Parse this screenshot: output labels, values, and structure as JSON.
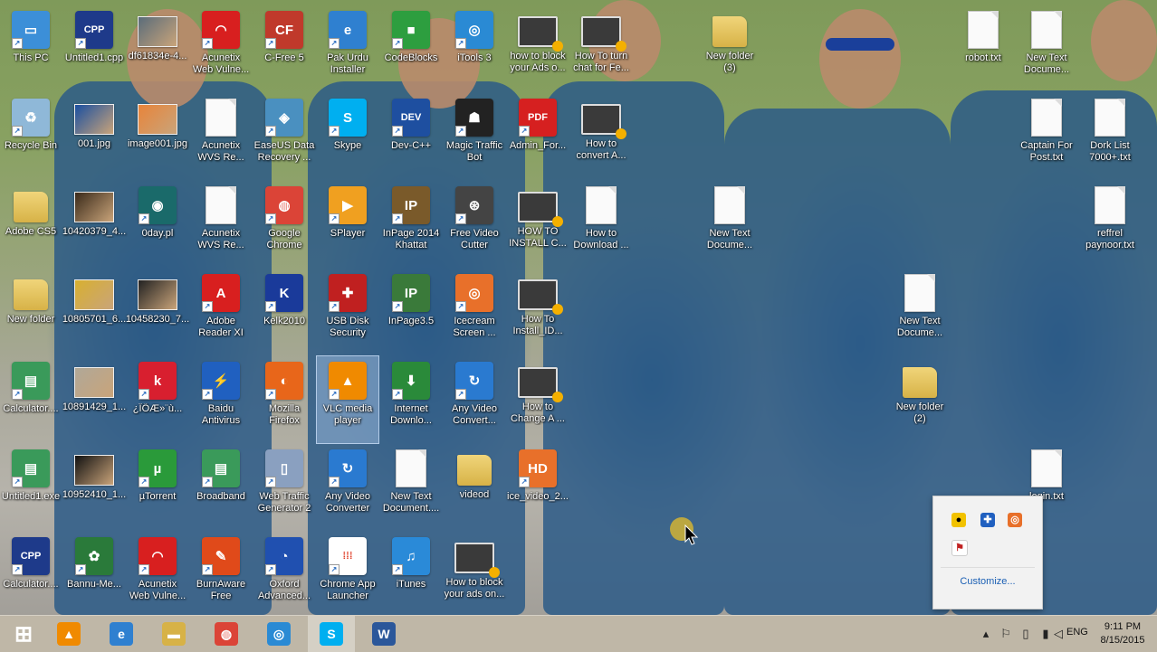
{
  "desktop": {
    "icons": [
      {
        "label": "This PC",
        "icon": "monitor-icon",
        "kind": "app",
        "color": "#3c8fd8",
        "glyph": "▭"
      },
      {
        "label": "Untitled1.cpp",
        "icon": "cpp-file-icon",
        "kind": "app",
        "color": "#1e3a8a",
        "glyph": "CPP"
      },
      {
        "label": "df61834e-4...",
        "icon": "image-file-icon",
        "kind": "photo",
        "color": "#5a6c7a",
        "glyph": ""
      },
      {
        "label": "Acunetix\nWeb Vulne...",
        "icon": "acunetix-icon",
        "kind": "app",
        "color": "#d81f1f",
        "glyph": "◠"
      },
      {
        "label": "C-Free 5",
        "icon": "cfree-icon",
        "kind": "app",
        "color": "#c0392b",
        "glyph": "CF"
      },
      {
        "label": "Pak Urdu\nInstaller",
        "icon": "internet-explorer-icon",
        "kind": "app",
        "color": "#2f80d0",
        "glyph": "e"
      },
      {
        "label": "CodeBlocks",
        "icon": "codeblocks-icon",
        "kind": "app",
        "color": "#2d9e3f",
        "glyph": "■"
      },
      {
        "label": "iTools 3",
        "icon": "itools-icon",
        "kind": "app",
        "color": "#2a8ad4",
        "glyph": "◎"
      },
      {
        "label": "how to block\nyour Ads o...",
        "icon": "video-file-icon",
        "kind": "video",
        "color": "#333333",
        "glyph": ""
      },
      {
        "label": "How To turn\nchat for Fe...",
        "icon": "video-file-icon",
        "kind": "video",
        "color": "#333333",
        "glyph": ""
      },
      {
        "label": "New folder\n(3)",
        "icon": "folder-icon",
        "kind": "folder",
        "color": "#e0c060",
        "glyph": ""
      },
      {
        "label": "robot.txt",
        "icon": "text-file-icon",
        "kind": "txt",
        "color": "#fafafa",
        "glyph": ""
      },
      {
        "label": "New Text\nDocume...",
        "icon": "text-file-icon",
        "kind": "txt",
        "color": "#fafafa",
        "glyph": ""
      },
      {
        "label": "Recycle Bin",
        "icon": "recycle-bin-icon",
        "kind": "app",
        "color": "#8fb8d8",
        "glyph": "♻"
      },
      {
        "label": "001.jpg",
        "icon": "image-file-icon",
        "kind": "photo",
        "color": "#1a4fa0",
        "glyph": ""
      },
      {
        "label": "image001.jpg",
        "icon": "image-file-icon",
        "kind": "photo",
        "color": "#e8843a",
        "glyph": ""
      },
      {
        "label": "Acunetix\nWVS Re...",
        "icon": "document-icon",
        "kind": "txt",
        "color": "#fafafa",
        "glyph": ""
      },
      {
        "label": "EaseUS Data\nRecovery ...",
        "icon": "easeus-icon",
        "kind": "app",
        "color": "#4a90c0",
        "glyph": "◈"
      },
      {
        "label": "Skype",
        "icon": "skype-icon",
        "kind": "app",
        "color": "#00aff0",
        "glyph": "S"
      },
      {
        "label": "Dev-C++",
        "icon": "devcpp-icon",
        "kind": "app",
        "color": "#1e4fa0",
        "glyph": "DEV"
      },
      {
        "label": "Magic Traffic\nBot",
        "icon": "magic-traffic-bot-icon",
        "kind": "app",
        "color": "#222222",
        "glyph": "☗"
      },
      {
        "label": "Admin_For...",
        "icon": "pdf-file-icon",
        "kind": "app",
        "color": "#d62020",
        "glyph": "PDF"
      },
      {
        "label": "How to\nconvert A...",
        "icon": "video-file-icon",
        "kind": "video",
        "color": "#333333",
        "glyph": ""
      },
      {
        "label": "Captain For\nPost.txt",
        "icon": "text-file-icon",
        "kind": "txt",
        "color": "#fafafa",
        "glyph": ""
      },
      {
        "label": "Dork List\n7000+.txt",
        "icon": "text-file-icon",
        "kind": "txt",
        "color": "#fafafa",
        "glyph": ""
      },
      {
        "label": "Adobe CS5",
        "icon": "folder-icon",
        "kind": "folder",
        "color": "#e0c060",
        "glyph": ""
      },
      {
        "label": "10420379_4...",
        "icon": "image-file-icon",
        "kind": "photo",
        "color": "#3a2a1a",
        "glyph": ""
      },
      {
        "label": "0day.pl",
        "icon": "0day-icon",
        "kind": "app",
        "color": "#1a6a6a",
        "glyph": "◉"
      },
      {
        "label": "Acunetix\nWVS Re...",
        "icon": "document-icon",
        "kind": "txt",
        "color": "#fafafa",
        "glyph": ""
      },
      {
        "label": "Google\nChrome",
        "icon": "chrome-icon",
        "kind": "app",
        "color": "#db4437",
        "glyph": "◍"
      },
      {
        "label": "SPlayer",
        "icon": "splayer-icon",
        "kind": "app",
        "color": "#f0a020",
        "glyph": "▶"
      },
      {
        "label": "InPage 2014\nKhattat",
        "icon": "inpage-icon",
        "kind": "app",
        "color": "#7a5a2a",
        "glyph": "IP"
      },
      {
        "label": "Free Video\nCutter",
        "icon": "film-reel-icon",
        "kind": "app",
        "color": "#444444",
        "glyph": "⊛"
      },
      {
        "label": "HOW TO\nINSTALL C...",
        "icon": "video-file-icon",
        "kind": "video",
        "color": "#333333",
        "glyph": ""
      },
      {
        "label": "How to\nDownload ...",
        "icon": "word-document-icon",
        "kind": "txt",
        "color": "#fafafa",
        "glyph": ""
      },
      {
        "label": "New Text\nDocume...",
        "icon": "text-file-icon",
        "kind": "txt",
        "color": "#fafafa",
        "glyph": ""
      },
      {
        "label": "reffrel\npaynoor.txt",
        "icon": "text-file-icon",
        "kind": "txt",
        "color": "#fafafa",
        "glyph": ""
      },
      {
        "label": "New folder",
        "icon": "folder-icon",
        "kind": "folder",
        "color": "#e0c060",
        "glyph": ""
      },
      {
        "label": "10805701_6...",
        "icon": "image-file-icon",
        "kind": "photo",
        "color": "#d8b030",
        "glyph": ""
      },
      {
        "label": "10458230_7...",
        "icon": "image-file-icon",
        "kind": "photo",
        "color": "#222222",
        "glyph": ""
      },
      {
        "label": "Adobe\nReader XI",
        "icon": "adobe-reader-icon",
        "kind": "app",
        "color": "#d81f1f",
        "glyph": "A"
      },
      {
        "label": "Kelk2010",
        "icon": "kelk-icon",
        "kind": "app",
        "color": "#1a3a9a",
        "glyph": "K"
      },
      {
        "label": "USB Disk\nSecurity",
        "icon": "shield-icon",
        "kind": "app",
        "color": "#c02020",
        "glyph": "✚"
      },
      {
        "label": "InPage3.5",
        "icon": "inpage-icon",
        "kind": "app",
        "color": "#3a7a3a",
        "glyph": "IP"
      },
      {
        "label": "Icecream\nScreen ...",
        "icon": "icecream-icon",
        "kind": "app",
        "color": "#e8702a",
        "glyph": "◎"
      },
      {
        "label": "How To\nInstall_ID...",
        "icon": "video-file-icon",
        "kind": "video",
        "color": "#333333",
        "glyph": ""
      },
      {
        "label": "New Text\nDocume...",
        "icon": "text-file-icon",
        "kind": "txt",
        "color": "#fafafa",
        "glyph": ""
      },
      {
        "label": "Calculator....",
        "icon": "exe-file-icon",
        "kind": "app",
        "color": "#3a9a5a",
        "glyph": "▤"
      },
      {
        "label": "10891429_1...",
        "icon": "image-file-icon",
        "kind": "photo",
        "color": "#b0a898",
        "glyph": ""
      },
      {
        "label": "¿ÎÕÆ»¨ù...",
        "icon": "k-app-icon",
        "kind": "app",
        "color": "#d81f2f",
        "glyph": "k"
      },
      {
        "label": "Baidu\nAntivirus",
        "icon": "shield-icon",
        "kind": "app",
        "color": "#2060c0",
        "glyph": "⚡"
      },
      {
        "label": "Mozilla\nFirefox",
        "icon": "firefox-icon",
        "kind": "app",
        "color": "#e8661a",
        "glyph": "◐"
      },
      {
        "label": "VLC media\nplayer",
        "icon": "vlc-icon",
        "kind": "app",
        "color": "#f08a00",
        "glyph": "▲"
      },
      {
        "label": "Internet\nDownlo...",
        "icon": "internet-download-manager-icon",
        "kind": "app",
        "color": "#2a8a3a",
        "glyph": "⬇"
      },
      {
        "label": "Any Video\nConvert...",
        "icon": "any-video-converter-icon",
        "kind": "app",
        "color": "#2a7ad0",
        "glyph": "↻"
      },
      {
        "label": "How to\nChange A ...",
        "icon": "video-file-icon",
        "kind": "video",
        "color": "#333333",
        "glyph": ""
      },
      {
        "label": "New folder\n(2)",
        "icon": "folder-icon",
        "kind": "folder",
        "color": "#e0c060",
        "glyph": ""
      },
      {
        "label": "Untitled1.exe",
        "icon": "exe-file-icon",
        "kind": "app",
        "color": "#3a9a5a",
        "glyph": "▤"
      },
      {
        "label": "10952410_1...",
        "icon": "image-file-icon",
        "kind": "photo",
        "color": "#111111",
        "glyph": ""
      },
      {
        "label": "µTorrent",
        "icon": "utorrent-icon",
        "kind": "app",
        "color": "#2a9a3a",
        "glyph": "µ"
      },
      {
        "label": "Broadband",
        "icon": "broadband-icon",
        "kind": "app",
        "color": "#3a9a5a",
        "glyph": "▤"
      },
      {
        "label": "Web Traffic\nGenerator 2",
        "icon": "web-traffic-generator-icon",
        "kind": "app",
        "color": "#8aa0c0",
        "glyph": "▯"
      },
      {
        "label": "Any Video\nConverter",
        "icon": "any-video-converter-icon",
        "kind": "app",
        "color": "#2a7ad0",
        "glyph": "↻"
      },
      {
        "label": "New Text\nDocument....",
        "icon": "text-file-icon",
        "kind": "txt",
        "color": "#fafafa",
        "glyph": ""
      },
      {
        "label": "videod",
        "icon": "folder-icon",
        "kind": "folder",
        "color": "#e0c060",
        "glyph": ""
      },
      {
        "label": "ice_video_2...",
        "icon": "hd-video-icon",
        "kind": "app",
        "color": "#e8702a",
        "glyph": "HD"
      },
      {
        "label": "login.txt",
        "icon": "text-file-icon",
        "kind": "txt",
        "color": "#fafafa",
        "glyph": ""
      },
      {
        "label": "Calculator....",
        "icon": "cpp-file-icon",
        "kind": "app",
        "color": "#1e3a8a",
        "glyph": "CPP"
      },
      {
        "label": "Bannu-Me...",
        "icon": "emblem-icon",
        "kind": "app",
        "color": "#2a7a3a",
        "glyph": "✿"
      },
      {
        "label": "Acunetix\nWeb Vulne...",
        "icon": "acunetix-icon",
        "kind": "app",
        "color": "#d81f1f",
        "glyph": "◠"
      },
      {
        "label": "BurnAware\nFree",
        "icon": "burnaware-icon",
        "kind": "app",
        "color": "#e04a1a",
        "glyph": "✎"
      },
      {
        "label": "Oxford\nAdvanced...",
        "icon": "oxford-dictionary-icon",
        "kind": "app",
        "color": "#2050b0",
        "glyph": "◔"
      },
      {
        "label": "Chrome App\nLauncher",
        "icon": "app-launcher-icon",
        "kind": "app",
        "color": "#ffffff",
        "glyph": "⁞⁞⁞"
      },
      {
        "label": "iTunes",
        "icon": "itunes-icon",
        "kind": "app",
        "color": "#2a8ad8",
        "glyph": "♫"
      },
      {
        "label": "How to block\nyour ads on...",
        "icon": "video-file-icon",
        "kind": "video",
        "color": "#333333",
        "glyph": ""
      }
    ]
  },
  "tray_popup": {
    "icons": [
      "norton-icon",
      "shield-icon",
      "icecream-icon",
      "flag-icon"
    ],
    "customize_label": "Customize..."
  },
  "taskbar": {
    "items": [
      {
        "name": "start-button",
        "icon": "windows-logo-icon",
        "color": "#ffffff",
        "glyph": "⊞"
      },
      {
        "name": "taskbar-vlc",
        "icon": "vlc-icon",
        "color": "#f08a00",
        "glyph": "▲"
      },
      {
        "name": "taskbar-internet-explorer",
        "icon": "internet-explorer-icon",
        "color": "#2f80d0",
        "glyph": "e"
      },
      {
        "name": "taskbar-file-explorer",
        "icon": "folder-icon",
        "color": "#d7b247",
        "glyph": "▬"
      },
      {
        "name": "taskbar-chrome",
        "icon": "chrome-icon",
        "color": "#db4437",
        "glyph": "◍"
      },
      {
        "name": "taskbar-itools",
        "icon": "itools-icon",
        "color": "#2a8ad4",
        "glyph": "◎"
      },
      {
        "name": "taskbar-skype",
        "icon": "skype-icon",
        "color": "#00aff0",
        "glyph": "S"
      },
      {
        "name": "taskbar-word",
        "icon": "word-icon",
        "color": "#2b579a",
        "glyph": "W"
      }
    ],
    "tray_icons": [
      "show-hidden-icons-icon",
      "action-center-flag-icon",
      "network-icon",
      "signal-icon",
      "volume-icon"
    ],
    "language": "ENG",
    "time": "9:11 PM",
    "date": "8/15/2015"
  }
}
